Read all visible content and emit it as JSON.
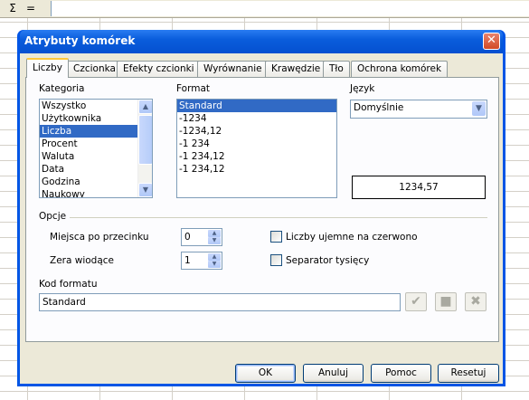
{
  "formula_bar": {
    "sum_symbol": "Σ",
    "equals_symbol": "="
  },
  "dialog": {
    "title": "Atrybuty komórek",
    "close_icon": "close-icon"
  },
  "tabs": [
    {
      "label": "Liczby",
      "active": true
    },
    {
      "label": "Czcionka"
    },
    {
      "label": "Efekty czcionki"
    },
    {
      "label": "Wyrównanie"
    },
    {
      "label": "Krawędzie"
    },
    {
      "label": "Tło"
    },
    {
      "label": "Ochrona komórek"
    }
  ],
  "category": {
    "label": "Kategoria",
    "items": [
      "Wszystko",
      "Użytkownika",
      "Liczba",
      "Procent",
      "Waluta",
      "Data",
      "Godzina",
      "Naukowy"
    ],
    "selected": "Liczba"
  },
  "format": {
    "label": "Format",
    "items": [
      "Standard",
      "-1234",
      "-1234,12",
      "-1 234",
      "-1 234,12",
      "-1 234,12"
    ],
    "selected": "Standard"
  },
  "language": {
    "label": "Język",
    "value": "Domyślnie"
  },
  "preview": {
    "value": "1234,57"
  },
  "options": {
    "label": "Opcje",
    "decimal_places": {
      "label": "Miejsca po przecinku",
      "value": "0"
    },
    "leading_zeros": {
      "label": "Zera wiodące",
      "value": "1"
    },
    "negative_red": {
      "label": "Liczby ujemne na czerwono",
      "checked": false
    },
    "thousands_sep": {
      "label": "Separator tysięcy",
      "checked": false
    }
  },
  "format_code": {
    "label": "Kod formatu",
    "value": "Standard"
  },
  "buttons": {
    "ok": "OK",
    "cancel": "Anuluj",
    "help": "Pomoc",
    "reset": "Resetuj"
  },
  "colors": {
    "title_bar": "#0a5ddc",
    "selection": "#316ac5",
    "dialog_bg": "#ece9d8",
    "close_button": "#d24a26"
  }
}
